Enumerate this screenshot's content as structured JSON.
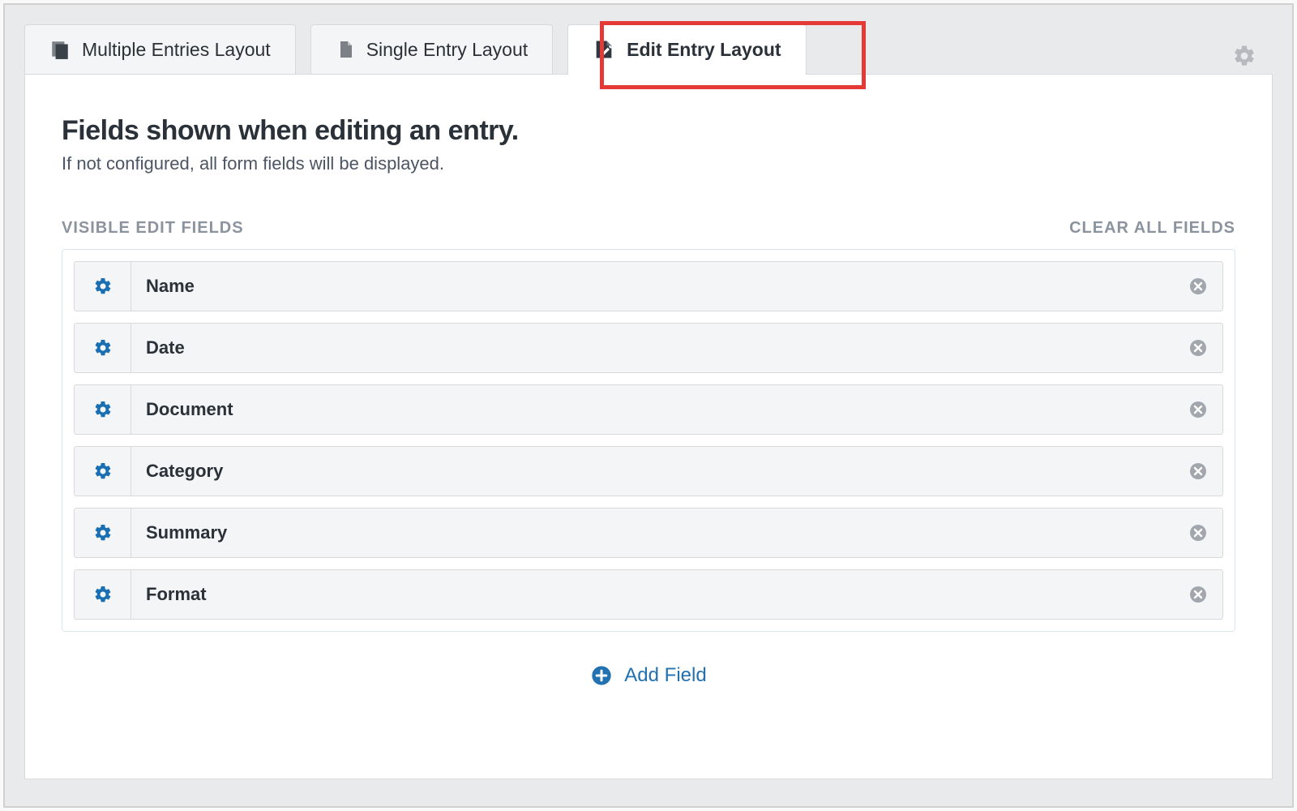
{
  "tabs": [
    {
      "label": "Multiple Entries Layout",
      "active": false,
      "icon": "stacked-pages-icon"
    },
    {
      "label": "Single Entry Layout",
      "active": false,
      "icon": "page-icon"
    },
    {
      "label": "Edit Entry Layout",
      "active": true,
      "icon": "edit-page-icon"
    }
  ],
  "header": {
    "title": "Fields shown when editing an entry.",
    "subtitle": "If not configured, all form fields will be displayed."
  },
  "section": {
    "label": "VISIBLE EDIT FIELDS",
    "clear": "CLEAR ALL FIELDS"
  },
  "fields": [
    {
      "label": "Name"
    },
    {
      "label": "Date"
    },
    {
      "label": "Document"
    },
    {
      "label": "Category"
    },
    {
      "label": "Summary"
    },
    {
      "label": "Format"
    }
  ],
  "add_field_label": "Add Field",
  "colors": {
    "accent": "#2271b1",
    "highlight": "#e53935"
  }
}
